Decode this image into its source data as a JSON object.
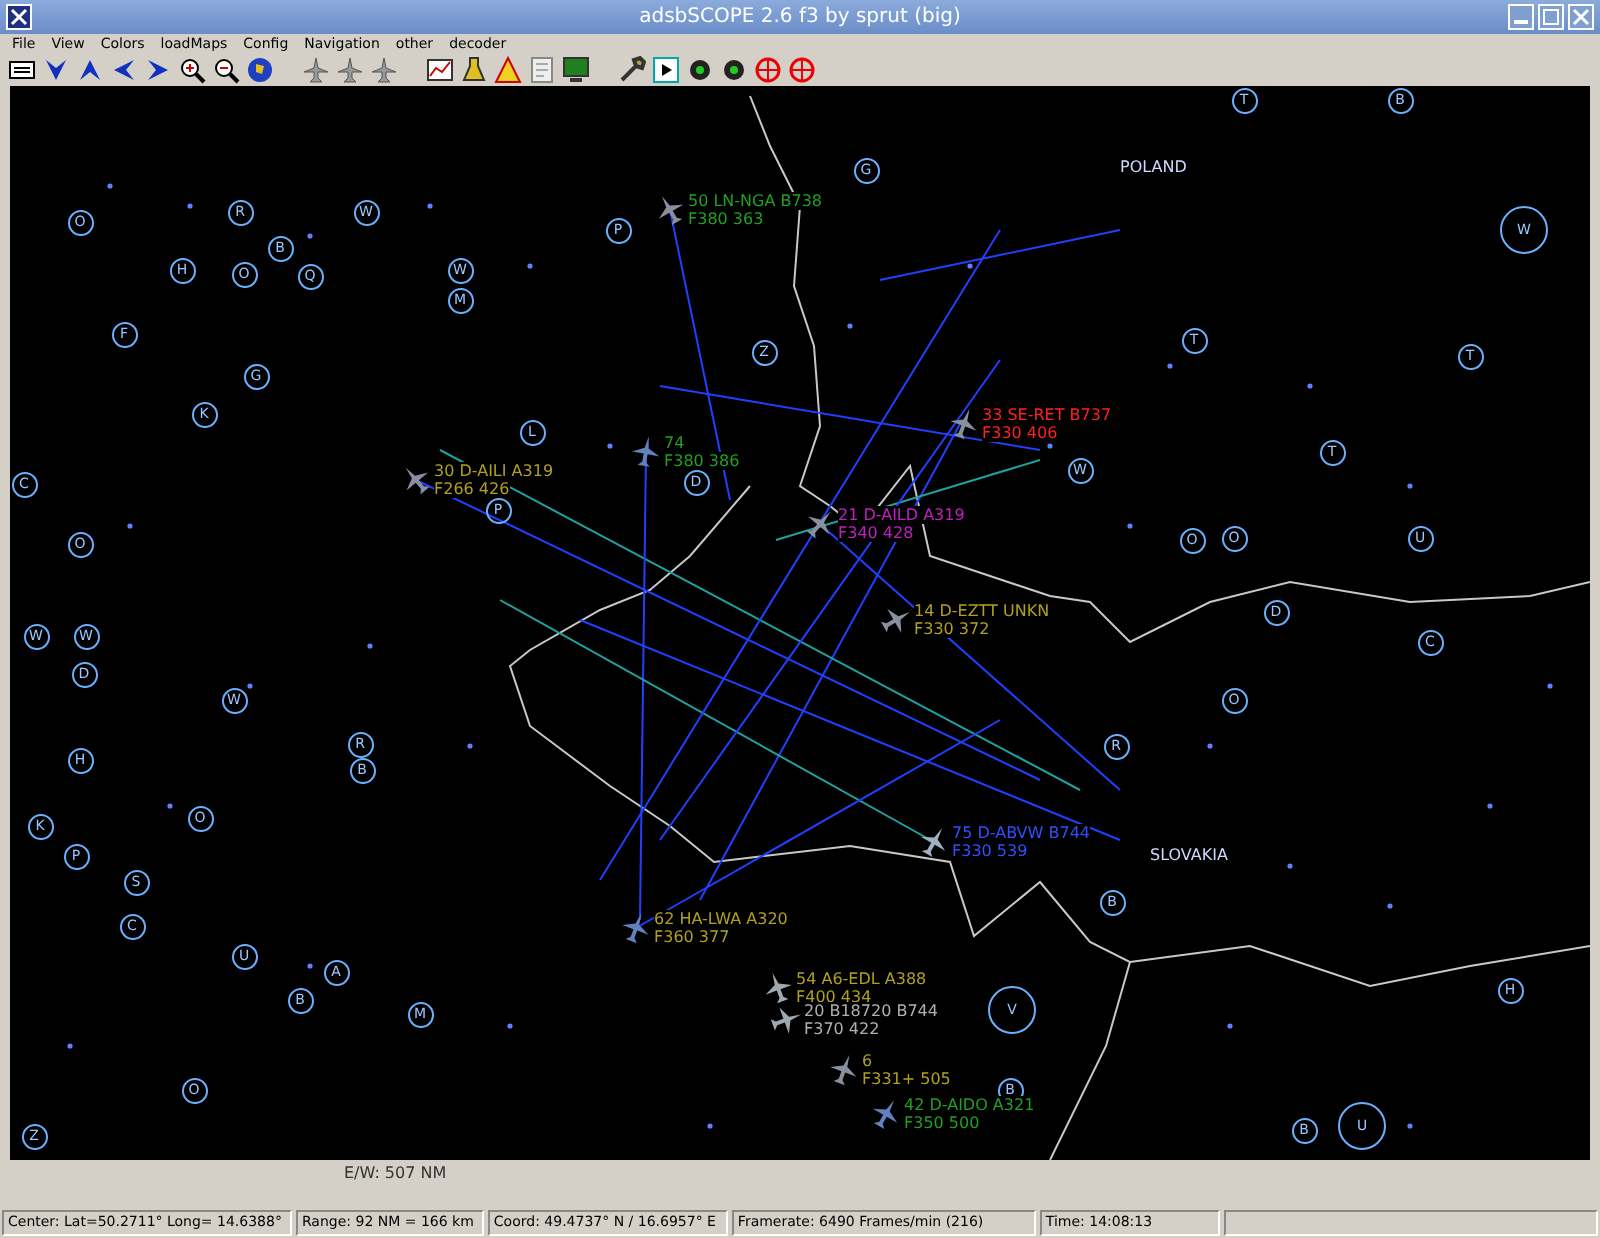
{
  "window": {
    "title": "adsbSCOPE 2.6 f3 by sprut  (big)"
  },
  "menu": [
    "File",
    "View",
    "Colors",
    "loadMaps",
    "Config",
    "Navigation",
    "other",
    "decoder"
  ],
  "map": {
    "country_labels": [
      "POLAND",
      "SLOVAKIA"
    ],
    "navaids": [
      "O",
      "R",
      "W",
      "B",
      "O",
      "Q",
      "W",
      "F",
      "G",
      "K",
      "C",
      "O",
      "W",
      "W",
      "D",
      "W",
      "R",
      "B",
      "H",
      "K",
      "P",
      "S",
      "O",
      "C",
      "U",
      "B",
      "A",
      "M",
      "Z",
      "O",
      "P",
      "P",
      "M",
      "L",
      "H",
      "G",
      "T",
      "B",
      "T",
      "W",
      "O",
      "O",
      "U",
      "T",
      "W",
      "T",
      "D",
      "C",
      "O",
      "R",
      "B",
      "V",
      "B",
      "U",
      "B",
      "H",
      "Z",
      "D"
    ],
    "aircraft": [
      {
        "line1": "50 LN-NGA B738",
        "line2": "F380 363",
        "color": "#20a020"
      },
      {
        "line1": "33 SE-RET B737",
        "line2": "F330 406",
        "color": "#ff2020"
      },
      {
        "line1": "30 D-AILI A319",
        "line2": "F266 426",
        "color": "#b0a020"
      },
      {
        "line1": "74",
        "line2": "F380 386",
        "color": "#20a020"
      },
      {
        "line1": "21 D-AILD A319",
        "line2": "F340 428",
        "color": "#c020c0"
      },
      {
        "line1": "14 D-EZTT UNKN",
        "line2": "F330 372",
        "color": "#b0a020"
      },
      {
        "line1": "75 D-ABVW B744",
        "line2": "F330 539",
        "color": "#3050ff"
      },
      {
        "line1": "62 HA-LWA A320",
        "line2": "F360 377",
        "color": "#b0a020"
      },
      {
        "line1": "54 A6-EDL A388",
        "line2": "F400 434",
        "color": "#b0a020"
      },
      {
        "line1": "20 B18720 B744",
        "line2": "F370 422",
        "color": "#b0b0b0"
      },
      {
        "line1": "6",
        "line2": "F331+ 505",
        "color": "#b0a020"
      },
      {
        "line1": "42 D-AIDO A321",
        "line2": "F350 500",
        "color": "#20a020"
      }
    ]
  },
  "scale": "E/W: 507 NM",
  "status_bar": [
    "Center: Lat=50.2711° Long= 14.6388°",
    "Range: 92 NM = 166 km",
    "Coord: 49.4737° N / 16.6957° E",
    "Framerate:  6490 Frames/min (216)",
    "Time: 14:08:13"
  ]
}
